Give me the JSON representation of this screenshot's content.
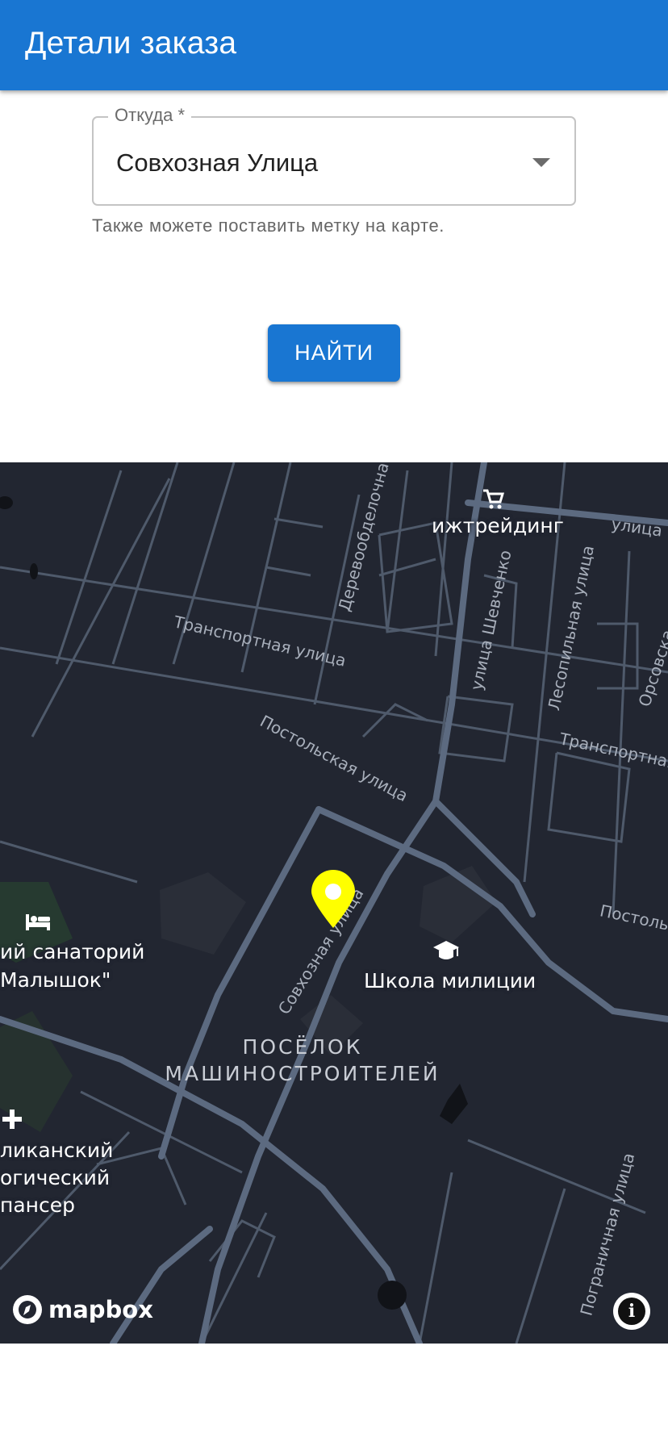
{
  "appbar": {
    "title": "Детали заказа"
  },
  "form": {
    "from_label": "Откуда *",
    "from_value": "Совхозная Улица",
    "helper": "Также можете поставить метку на карте.",
    "find_label": "НАЙТИ"
  },
  "map": {
    "streets": {
      "derevoobdelochnaya": "Деревообделочна",
      "ulitsa_top": "улица",
      "transportnaya": "Транспортная улица",
      "shevchenko": "улица Шевченко",
      "lesopilnaya": "Лесопильная улица",
      "orsovskaya": "Орсовска",
      "postolskaya": "Постольская улица",
      "transportnaya_right": "Транспортная",
      "postol_right": "Постоль",
      "sovkhoznaya": "Совхозная улица",
      "pogranichnaya": "Пограничная улица"
    },
    "pois": {
      "shop": "ижтрейдинг",
      "school": "Школа милиции",
      "sanatorium_line1": "ий санаторий",
      "sanatorium_line2": "Малышок\"",
      "dispensary_line1": "ликанский",
      "dispensary_line2": "огический",
      "dispensary_line3": "пансер"
    },
    "district_line1": "ПОСЁЛОК",
    "district_line2": "МАШИНОСТРОИТЕЛЕЙ",
    "attribution": "mapbox",
    "info_glyph": "i",
    "icons": [
      "cart-icon",
      "graduation-cap-icon",
      "bed-icon",
      "hospital-cross-icon",
      "location-pin-icon",
      "info-icon",
      "mapbox-logo-icon"
    ],
    "pin_color": "#ffff00"
  },
  "colors": {
    "primary": "#1976d2",
    "map_bg": "#222631",
    "road": "#4f5a6b",
    "park": "#2a3a33"
  }
}
